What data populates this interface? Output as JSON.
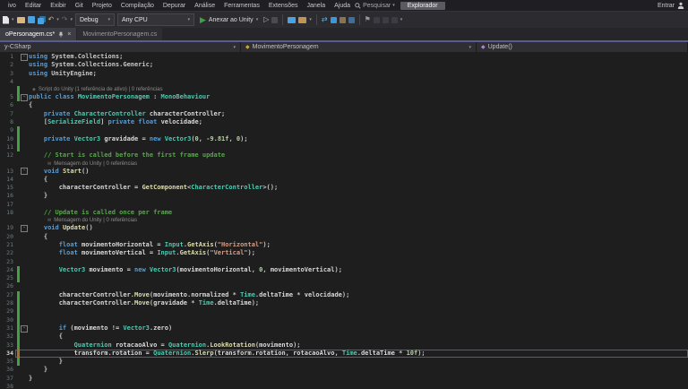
{
  "colors": {
    "accent_purple": "#5b5b8d",
    "change_bar_green": "#45a043",
    "change_bar_orange": "#a8702a",
    "run_green": "#43a047",
    "editor_bg": "#1e1e1e"
  },
  "menu": {
    "items": [
      "ivo",
      "Editar",
      "Exibir",
      "Git",
      "Projeto",
      "Compilação",
      "Depurar",
      "Análise",
      "Ferramentas",
      "Extensões",
      "Janela",
      "Ajuda"
    ],
    "search_label": "Pesquisar",
    "search_box_text": "Explorador",
    "signin_label": "Entrar"
  },
  "toolbar": {
    "debug_config": "Debug",
    "cpu_config": "Any CPU",
    "run_label": "Anexar ao Unity"
  },
  "tabs": {
    "active": "oPersonagem.cs*",
    "inactive": "MovimentoPersonagem.cs"
  },
  "breadcrumb": {
    "project": "y-CSharp",
    "class": "MovimentoPersonagem",
    "member": "Update()"
  },
  "editor": {
    "lens_separator": "|",
    "rows": [
      {
        "n": "1",
        "fold": true,
        "t": [
          [
            "k",
            "using"
          ],
          [
            "p",
            " System.Collections;"
          ]
        ]
      },
      {
        "n": "2",
        "t": [
          [
            "k",
            "using"
          ],
          [
            "p",
            " System.Collections.Generic;"
          ]
        ]
      },
      {
        "n": "3",
        "t": [
          [
            "k",
            "using"
          ],
          [
            "p",
            " UnityEngine;"
          ]
        ]
      },
      {
        "n": "4",
        "t": []
      },
      {
        "type": "lens",
        "icon": "unity",
        "ind": 0,
        "bar": "g",
        "text": "Script do Unity (1 referência de ativo)",
        "refs": "0 referências"
      },
      {
        "n": "5",
        "fold": true,
        "bar": "g",
        "t": [
          [
            "k",
            "public"
          ],
          [
            "p",
            " "
          ],
          [
            "k",
            "class"
          ],
          [
            "p",
            " "
          ],
          [
            "t",
            "MovimentoPersonagem"
          ],
          [
            "p",
            " : "
          ],
          [
            "t",
            "MonoBehaviour"
          ]
        ]
      },
      {
        "n": "6",
        "t": [
          [
            "p",
            "{"
          ]
        ]
      },
      {
        "n": "7",
        "t": [
          [
            "p",
            "    "
          ],
          [
            "k",
            "private"
          ],
          [
            "p",
            " "
          ],
          [
            "t",
            "CharacterController"
          ],
          [
            "p",
            " "
          ],
          [
            "v",
            "characterController"
          ],
          [
            "p",
            ";"
          ]
        ]
      },
      {
        "n": "8",
        "t": [
          [
            "p",
            "    ["
          ],
          [
            "t",
            "SerializeField"
          ],
          [
            "p",
            "] "
          ],
          [
            "k",
            "private"
          ],
          [
            "p",
            " "
          ],
          [
            "k",
            "float"
          ],
          [
            "p",
            " "
          ],
          [
            "v",
            "velocidade"
          ],
          [
            "p",
            ";"
          ]
        ]
      },
      {
        "n": "9",
        "bar": "g",
        "t": []
      },
      {
        "n": "10",
        "bar": "g",
        "t": [
          [
            "p",
            "    "
          ],
          [
            "k",
            "private"
          ],
          [
            "p",
            " "
          ],
          [
            "t",
            "Vector3"
          ],
          [
            "p",
            " "
          ],
          [
            "v",
            "gravidade"
          ],
          [
            "p",
            " = "
          ],
          [
            "k",
            "new"
          ],
          [
            "p",
            " "
          ],
          [
            "t",
            "Vector3"
          ],
          [
            "p",
            "("
          ],
          [
            "n",
            "0"
          ],
          [
            "p",
            ", "
          ],
          [
            "n",
            "-9.81f"
          ],
          [
            "p",
            ", "
          ],
          [
            "n",
            "0"
          ],
          [
            "p",
            ");"
          ]
        ]
      },
      {
        "n": "11",
        "bar": "g",
        "t": []
      },
      {
        "n": "12",
        "t": [
          [
            "p",
            "    "
          ],
          [
            "c",
            "// Start is called before the first frame update"
          ]
        ]
      },
      {
        "type": "lens",
        "icon": "msg",
        "ind": 1,
        "text": "Mensagem do Unity",
        "refs": "0 referências"
      },
      {
        "n": "13",
        "fold": true,
        "t": [
          [
            "p",
            "    "
          ],
          [
            "k",
            "void"
          ],
          [
            "p",
            " "
          ],
          [
            "m",
            "Start"
          ],
          [
            "p",
            "()"
          ]
        ]
      },
      {
        "n": "14",
        "t": [
          [
            "p",
            "    {"
          ]
        ]
      },
      {
        "n": "15",
        "t": [
          [
            "p",
            "        "
          ],
          [
            "v",
            "characterController"
          ],
          [
            "p",
            " = "
          ],
          [
            "m",
            "GetComponent"
          ],
          [
            "p",
            "<"
          ],
          [
            "t",
            "CharacterController"
          ],
          [
            "p",
            ">();"
          ]
        ]
      },
      {
        "n": "16",
        "t": [
          [
            "p",
            "    }"
          ]
        ]
      },
      {
        "n": "17",
        "t": []
      },
      {
        "n": "18",
        "t": [
          [
            "p",
            "    "
          ],
          [
            "c",
            "// Update is called once per frame"
          ]
        ]
      },
      {
        "type": "lens",
        "icon": "msg",
        "ind": 1,
        "text": "Mensagem do Unity",
        "refs": "0 referências"
      },
      {
        "n": "19",
        "fold": true,
        "t": [
          [
            "p",
            "    "
          ],
          [
            "k",
            "void"
          ],
          [
            "p",
            " "
          ],
          [
            "m",
            "Update"
          ],
          [
            "p",
            "()"
          ]
        ]
      },
      {
        "n": "20",
        "t": [
          [
            "p",
            "    {"
          ]
        ]
      },
      {
        "n": "21",
        "t": [
          [
            "p",
            "        "
          ],
          [
            "k",
            "float"
          ],
          [
            "p",
            " "
          ],
          [
            "v",
            "movimentoHorizontal"
          ],
          [
            "p",
            " = "
          ],
          [
            "t",
            "Input"
          ],
          [
            "p",
            "."
          ],
          [
            "m",
            "GetAxis"
          ],
          [
            "p",
            "("
          ],
          [
            "s",
            "\"Horizontal\""
          ],
          [
            "p",
            ");"
          ]
        ]
      },
      {
        "n": "22",
        "t": [
          [
            "p",
            "        "
          ],
          [
            "k",
            "float"
          ],
          [
            "p",
            " "
          ],
          [
            "v",
            "movimentoVertical"
          ],
          [
            "p",
            " = "
          ],
          [
            "t",
            "Input"
          ],
          [
            "p",
            "."
          ],
          [
            "m",
            "GetAxis"
          ],
          [
            "p",
            "("
          ],
          [
            "s",
            "\"Vertical\""
          ],
          [
            "p",
            ");"
          ]
        ]
      },
      {
        "n": "23",
        "t": []
      },
      {
        "n": "24",
        "bar": "g",
        "t": [
          [
            "p",
            "        "
          ],
          [
            "t",
            "Vector3"
          ],
          [
            "p",
            " "
          ],
          [
            "v",
            "movimento"
          ],
          [
            "p",
            " = "
          ],
          [
            "k",
            "new"
          ],
          [
            "p",
            " "
          ],
          [
            "t",
            "Vector3"
          ],
          [
            "p",
            "("
          ],
          [
            "v",
            "movimentoHorizontal"
          ],
          [
            "p",
            ", "
          ],
          [
            "n",
            "0"
          ],
          [
            "p",
            ", "
          ],
          [
            "v",
            "movimentoVertical"
          ],
          [
            "p",
            ");"
          ]
        ]
      },
      {
        "n": "25",
        "bar": "g",
        "t": []
      },
      {
        "n": "26",
        "t": []
      },
      {
        "n": "27",
        "bar": "g",
        "t": [
          [
            "p",
            "        "
          ],
          [
            "v",
            "characterController"
          ],
          [
            "p",
            "."
          ],
          [
            "m",
            "Move"
          ],
          [
            "p",
            "("
          ],
          [
            "v",
            "movimento"
          ],
          [
            "p",
            "."
          ],
          [
            "v",
            "normalized"
          ],
          [
            "p",
            " * "
          ],
          [
            "t",
            "Time"
          ],
          [
            "p",
            "."
          ],
          [
            "v",
            "deltaTime"
          ],
          [
            "p",
            " * "
          ],
          [
            "v",
            "velocidade"
          ],
          [
            "p",
            ");"
          ]
        ]
      },
      {
        "n": "28",
        "bar": "g",
        "t": [
          [
            "p",
            "        "
          ],
          [
            "v",
            "characterController"
          ],
          [
            "p",
            "."
          ],
          [
            "m",
            "Move"
          ],
          [
            "p",
            "("
          ],
          [
            "v",
            "gravidade"
          ],
          [
            "p",
            " * "
          ],
          [
            "t",
            "Time"
          ],
          [
            "p",
            "."
          ],
          [
            "v",
            "deltaTime"
          ],
          [
            "p",
            ");"
          ]
        ]
      },
      {
        "n": "29",
        "bar": "g",
        "t": []
      },
      {
        "n": "30",
        "bar": "g",
        "t": []
      },
      {
        "n": "31",
        "fold": true,
        "bar": "g",
        "t": [
          [
            "p",
            "        "
          ],
          [
            "k",
            "if"
          ],
          [
            "p",
            " ("
          ],
          [
            "v",
            "movimento"
          ],
          [
            "p",
            " != "
          ],
          [
            "t",
            "Vector3"
          ],
          [
            "p",
            "."
          ],
          [
            "v",
            "zero"
          ],
          [
            "p",
            ")"
          ]
        ]
      },
      {
        "n": "32",
        "bar": "g",
        "t": [
          [
            "p",
            "        {"
          ]
        ]
      },
      {
        "n": "33",
        "bar": "g",
        "t": [
          [
            "p",
            "            "
          ],
          [
            "t",
            "Quaternion"
          ],
          [
            "p",
            " "
          ],
          [
            "v",
            "rotacaoAlvo"
          ],
          [
            "p",
            " = "
          ],
          [
            "t",
            "Quaternion"
          ],
          [
            "p",
            "."
          ],
          [
            "m",
            "LookRotation"
          ],
          [
            "p",
            "("
          ],
          [
            "v",
            "movimento"
          ],
          [
            "p",
            ");"
          ]
        ]
      },
      {
        "n": "34",
        "bar": "o",
        "cur": true,
        "t": [
          [
            "p",
            "            "
          ],
          [
            "v",
            "transform"
          ],
          [
            "p",
            "."
          ],
          [
            "v",
            "rotation"
          ],
          [
            "p",
            " = "
          ],
          [
            "t",
            "Quaternion"
          ],
          [
            "p",
            "."
          ],
          [
            "m",
            "Slerp"
          ],
          [
            "p",
            "("
          ],
          [
            "v",
            "transform"
          ],
          [
            "p",
            "."
          ],
          [
            "v",
            "rotation"
          ],
          [
            "p",
            ", "
          ],
          [
            "v",
            "rotacaoAlvo"
          ],
          [
            "p",
            ", "
          ],
          [
            "t",
            "Time"
          ],
          [
            "p",
            "."
          ],
          [
            "v",
            "deltaTime"
          ],
          [
            "p",
            " * "
          ],
          [
            "n",
            "10f"
          ],
          [
            "p",
            ");"
          ]
        ]
      },
      {
        "n": "35",
        "bar": "g",
        "t": [
          [
            "p",
            "        }"
          ]
        ]
      },
      {
        "n": "36",
        "t": [
          [
            "p",
            "    }"
          ]
        ]
      },
      {
        "n": "37",
        "t": [
          [
            "p",
            "}"
          ]
        ]
      },
      {
        "n": "38",
        "t": []
      }
    ]
  }
}
